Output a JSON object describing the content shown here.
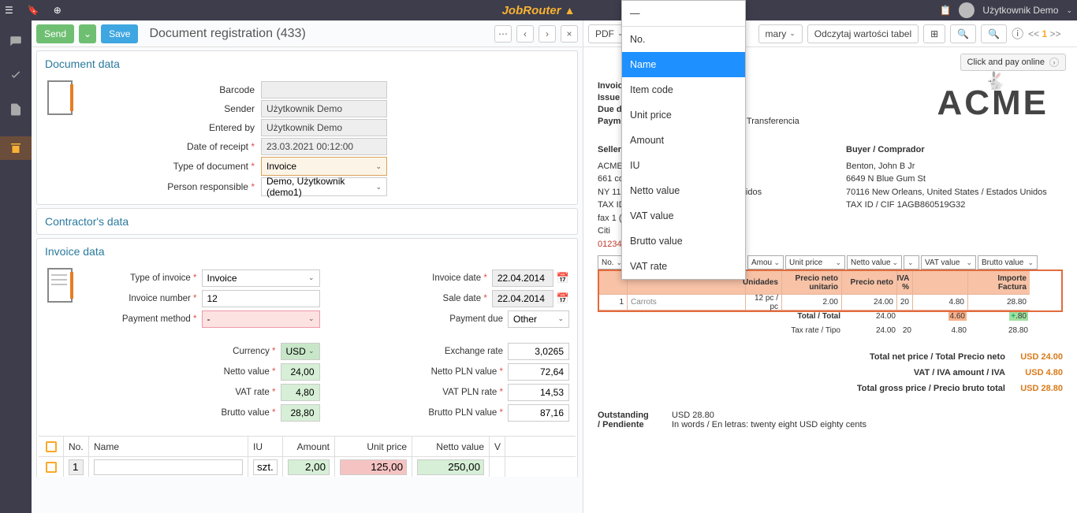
{
  "topbar": {
    "logo": "JobRouter",
    "user": "Użytkownik Demo"
  },
  "header": {
    "send": "Send",
    "save": "Save",
    "title": "Document registration (433)"
  },
  "docdata": {
    "title": "Document data",
    "barcode_l": "Barcode",
    "barcode": "",
    "sender_l": "Sender",
    "sender": "Użytkownik Demo",
    "entered_l": "Entered by",
    "entered": "Użytkownik Demo",
    "receipt_l": "Date of receipt",
    "receipt": "23.03.2021 00:12:00",
    "type_l": "Type of document",
    "type": "Invoice",
    "resp_l": "Person responsible",
    "resp": "Demo, Użytkownik (demo1)"
  },
  "contractor": {
    "title": "Contractor's data"
  },
  "invoice": {
    "title": "Invoice data",
    "left": {
      "type_l": "Type of invoice",
      "type": "Invoice",
      "num_l": "Invoice number",
      "num": "12",
      "pay_l": "Payment method",
      "pay": "-",
      "cur_l": "Currency",
      "cur": "USD",
      "netto_l": "Netto value",
      "netto": "24,00",
      "vat_l": "VAT rate",
      "vat": "4,80",
      "brutto_l": "Brutto value",
      "brutto": "28,80"
    },
    "right": {
      "date_l": "Invoice date",
      "date": "22.04.2014",
      "sale_l": "Sale date",
      "sale": "22.04.2014",
      "due_l": "Payment due",
      "due": "Other",
      "ex_l": "Exchange rate",
      "ex": "3,0265",
      "netto_l": "Netto PLN value",
      "netto": "72,64",
      "vat_l": "VAT PLN rate",
      "vat": "14,53",
      "brutto_l": "Brutto PLN value",
      "brutto": "87,16"
    },
    "table": {
      "h": {
        "no": "No.",
        "name": "Name",
        "iu": "IU",
        "amt": "Amount",
        "up": "Unit price",
        "nv": "Netto value",
        "vv": "V"
      },
      "r": {
        "no": "1",
        "name": "",
        "iu": "szt.",
        "amt": "2,00",
        "up": "125,00",
        "nv": "250,00"
      }
    }
  },
  "right_tb": {
    "pdf": "PDF",
    "summary": "mary",
    "read": "Odczytaj wartości tabel",
    "pg_prev": "<<",
    "pg": "1",
    "pg_next": ">>"
  },
  "dropdown": [
    "—",
    "No.",
    "Name",
    "Item code",
    "Unit price",
    "Amount",
    "IU",
    "Netto value",
    "VAT value",
    "Brutto value",
    "VAT rate"
  ],
  "doc": {
    "click_pay": "Click and pay online",
    "inv_l": "Invoice /",
    "issue_l": "Issue da",
    "due_l": "Due date",
    "pay_l": "Payment",
    "pay_v": "Transferencia",
    "seller_h": "Seller / ",
    "seller": [
      "ACME C",
      "661 cone",
      "NY 1121",
      "TAX ID /",
      "fax 1 (21",
      "Citi",
      "01234567"
    ],
    "vat_label_intrude": "VAT value",
    "buyer_h": "Buyer / Comprador",
    "buyer": [
      "Benton, John B Jr",
      "6649 N Blue Gum St",
      "70116 New Orleans, United States / Estados Unidos",
      "TAX ID / CIF 1AGB860519G32"
    ],
    "li_sel": [
      "No.",
      "Name",
      "Amou",
      "Unit price",
      "Netto value",
      "",
      "VAT value",
      "Brutto value"
    ],
    "li_hdr": [
      "",
      "",
      "Unidades",
      "Precio neto unitario",
      "Precio neto",
      "IVA %",
      "",
      "Importe Factura"
    ],
    "li_row": [
      "1",
      "Carrots",
      "12 pc / pc",
      "2.00",
      "24.00",
      "20",
      "4.80",
      "28.80"
    ],
    "li_tot1": [
      "Total / Total",
      "",
      "24.00",
      "",
      "4.60",
      "28.80"
    ],
    "li_tot2": [
      "Tax rate / Tipo",
      "",
      "24.00",
      "20",
      "4.80",
      "28.80"
    ],
    "totals": {
      "net_l": "Total net price / Total Precio neto",
      "net": "USD 24.00",
      "vat_l": "VAT / IVA amount / IVA",
      "vat": "USD 4.80",
      "gross_l": "Total gross price / Precio bruto total",
      "gross": "USD 28.80"
    },
    "out_l": "Outstanding / Pendiente",
    "out_v": "USD 28.80",
    "words": "In words / En letras: twenty eight USD eighty cents"
  }
}
